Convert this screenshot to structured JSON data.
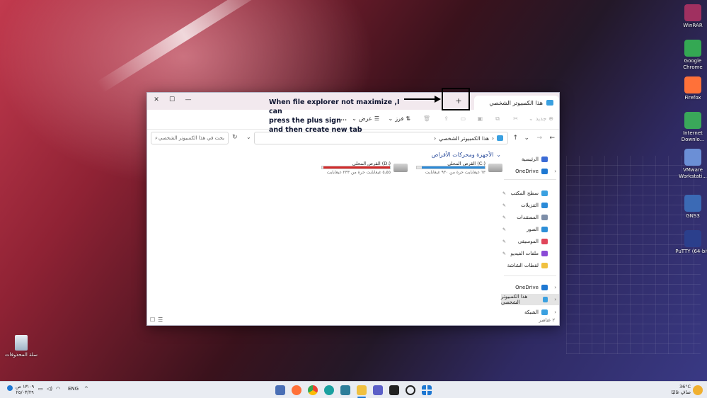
{
  "desktop": {
    "icons_right": [
      {
        "label": "WinRAR",
        "color": "#a03060"
      },
      {
        "label": "Google Chrome",
        "color": "#34a853"
      },
      {
        "label": "Firefox",
        "color": "#ff7139"
      },
      {
        "label": "Internet Downlo...",
        "color": "#3aa85a"
      },
      {
        "label": "VMware Workstati...",
        "color": "#6b8fd6"
      },
      {
        "label": "GNS3",
        "color": "#3b6ab5"
      },
      {
        "label": "PuTTY (64-bit)",
        "color": "#2b3f8c"
      }
    ],
    "recycle_bin": {
      "label": "سلة المحذوفات"
    }
  },
  "window": {
    "tab_title": "هذا الكمبيوتر الشخصي",
    "tab_close": "✕",
    "new_tab": "+",
    "controls": {
      "minimize": "—",
      "maximize": "☐",
      "close": "✕"
    },
    "toolbar": {
      "new": "جديد",
      "sort": "فرز",
      "view": "عرض",
      "more": "..."
    },
    "address": "هذا الكمبيوتر الشخصي",
    "search_placeholder": "بحث في هذا الكمبيوتر الشخصي",
    "sidebar": [
      {
        "label": "الرئيسية",
        "icon": "home-icon",
        "color": "#3b6bd6"
      },
      {
        "label": "OneDrive",
        "icon": "cloud-icon",
        "color": "#1e78d2"
      },
      {
        "label": "سطح المكتب",
        "icon": "desktop-icon",
        "color": "#3aa0e0"
      },
      {
        "label": "التنزيلات",
        "icon": "download-icon",
        "color": "#2a8ad8"
      },
      {
        "label": "المستندات",
        "icon": "document-icon",
        "color": "#7d8ea8"
      },
      {
        "label": "الصور",
        "icon": "pictures-icon",
        "color": "#2e8fd8"
      },
      {
        "label": "الموسيقى",
        "icon": "music-icon",
        "color": "#e0455a"
      },
      {
        "label": "ملفات الفيديو",
        "icon": "video-icon",
        "color": "#8a4ad6"
      },
      {
        "label": "لقطات الشاشة",
        "icon": "folder-icon",
        "color": "#f0c040"
      },
      {
        "label": "OneDrive",
        "icon": "cloud-icon",
        "color": "#1e78d2"
      },
      {
        "label": "هذا الكمبيوتر الشخصي",
        "icon": "pc-icon",
        "color": "#3aa0e0"
      },
      {
        "label": "الشبكة",
        "icon": "network-icon",
        "color": "#3aa0e0"
      }
    ],
    "group_title": "الأجهزة ومحركات الأقراص",
    "drives": [
      {
        "name": "القرص المحلي (C:)",
        "free": "٦٣ غيغابايت حرة من ٩٣٠ غيغابايت",
        "used_fraction": 0.93,
        "color": "#2a8ad8"
      },
      {
        "name": "القرص المحلي (D:)",
        "free": "٥٫٥٥ غيغابايت حرة من ٢٣٣ غيغابايت",
        "used_fraction": 0.98,
        "color": "#d42a2a"
      }
    ],
    "status": "٢ عناصر"
  },
  "annotation": {
    "line1": "When file explorer not maximize ,I can",
    "line2": "press the plus sign",
    "line3": "and then create new tab"
  },
  "taskbar": {
    "weather_temp": "36°C",
    "weather_desc": "صافٍ غالبًا",
    "lang": "ENG",
    "time": "١٣:٠٩ ص",
    "date": "٢٥/٠٣/٢٩"
  }
}
